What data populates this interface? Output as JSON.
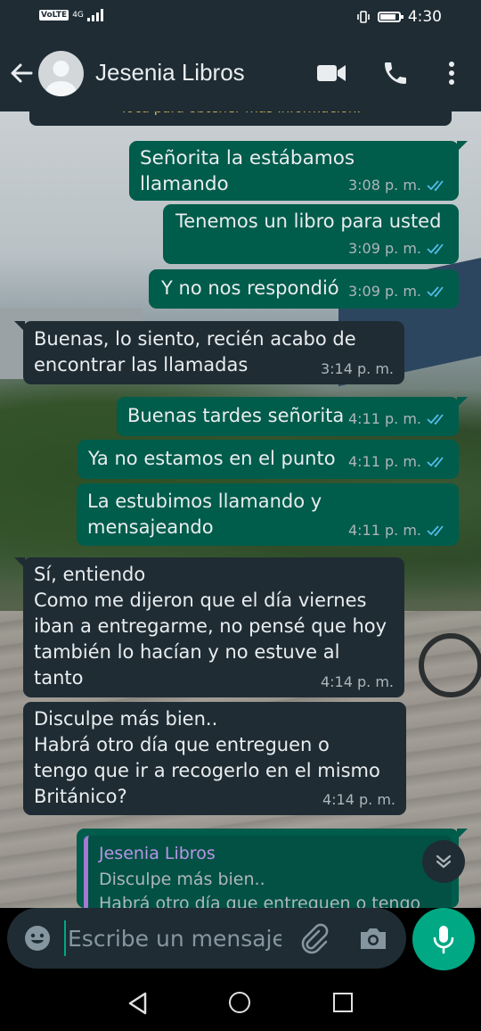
{
  "status_bar": {
    "network_label": "VoLTE",
    "network_type": "4G",
    "time": "4:30"
  },
  "header": {
    "contact_name": "Jesenia Libros"
  },
  "notice": {
    "text": "Toca para obtener más información."
  },
  "messages": [
    {
      "direction": "out",
      "text": "Señorita la estábamos llamando",
      "time": "3:08 p. m.",
      "read": true
    },
    {
      "direction": "out",
      "text": "Tenemos un libro para usted",
      "time": "3:09 p. m.",
      "read": true
    },
    {
      "direction": "out",
      "text": "Y no nos respondió",
      "time": "3:09 p. m.",
      "read": true
    },
    {
      "direction": "in",
      "text": "Buenas, lo siento, recién acabo de\nencontrar las llamadas",
      "time": "3:14 p. m."
    },
    {
      "direction": "out",
      "text": "Buenas tardes señorita",
      "time": "4:11 p. m.",
      "read": true
    },
    {
      "direction": "out",
      "text": "Ya no estamos en el punto",
      "time": "4:11 p. m.",
      "read": true
    },
    {
      "direction": "out",
      "text": "La estubimos llamando y\nmensajeando",
      "time": "4:11 p. m.",
      "read": true
    },
    {
      "direction": "in",
      "text": "Sí, entiendo\nComo me dijeron que el día viernes\niban a entregarme, no pensé que hoy\ntambién lo hacían y no estuve al\ntanto",
      "time": "4:14 p. m."
    },
    {
      "direction": "in",
      "text": "Disculpe más bien..\nHabrá otro día que entreguen o\ntengo que ir a recogerlo en el mismo\nBritánico?",
      "time": "4:14 p. m."
    }
  ],
  "reply": {
    "quoted_name": "Jesenia Libros",
    "quoted_text": "Disculpe más bien..\nHabrá otro día que entreguen o tengo"
  },
  "composer": {
    "placeholder": "Escribe un mensaje"
  },
  "colors": {
    "outgoing_bubble": "#005c4b",
    "incoming_bubble": "#1f2c34",
    "accent": "#00a884",
    "read_ticks": "#53bdeb"
  }
}
